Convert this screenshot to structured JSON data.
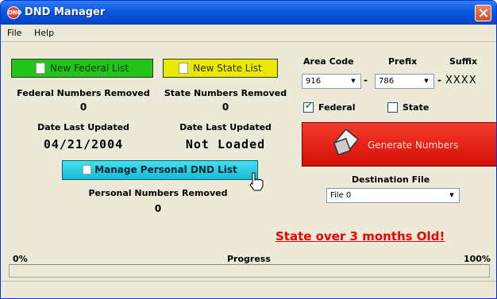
{
  "window": {
    "title": "DND Manager",
    "app_icon_text": "DND"
  },
  "menu": {
    "items": [
      "File",
      "Help"
    ]
  },
  "federal": {
    "button_label": "New Federal List",
    "removed_label": "Federal Numbers Removed",
    "removed_value": "0",
    "date_label": "Date Last Updated",
    "date_value": "04/21/2004"
  },
  "state": {
    "button_label": "New State List",
    "removed_label": "State Numbers Removed",
    "removed_value": "0",
    "date_label": "Date Last Updated",
    "date_value": "Not Loaded"
  },
  "personal": {
    "button_label": "Manage Personal DND List",
    "removed_label": "Personal Numbers Removed",
    "removed_value": "0"
  },
  "number": {
    "area_code_label": "Area Code",
    "area_code_value": "916",
    "prefix_label": "Prefix",
    "prefix_value": "786",
    "suffix_label": "Suffix",
    "suffix_value": "XXXX",
    "dash": "-"
  },
  "filters": {
    "federal_label": "Federal",
    "federal_checked": true,
    "state_label": "State",
    "state_checked": false
  },
  "generate": {
    "button_label": "Generate Numbers"
  },
  "destination": {
    "label": "Destination File",
    "value": "File 0"
  },
  "warning": {
    "text": "State over 3 months Old!"
  },
  "progress": {
    "min_label": "0%",
    "label": "Progress",
    "max_label": "100%",
    "value_percent": 0
  },
  "colors": {
    "federal_button": "#22c41a",
    "state_button": "#e8e800",
    "personal_button": "#18b9d6",
    "generate_button": "#d40f06",
    "warning_text": "#ee0000",
    "title_bar": "#0a58e0"
  }
}
